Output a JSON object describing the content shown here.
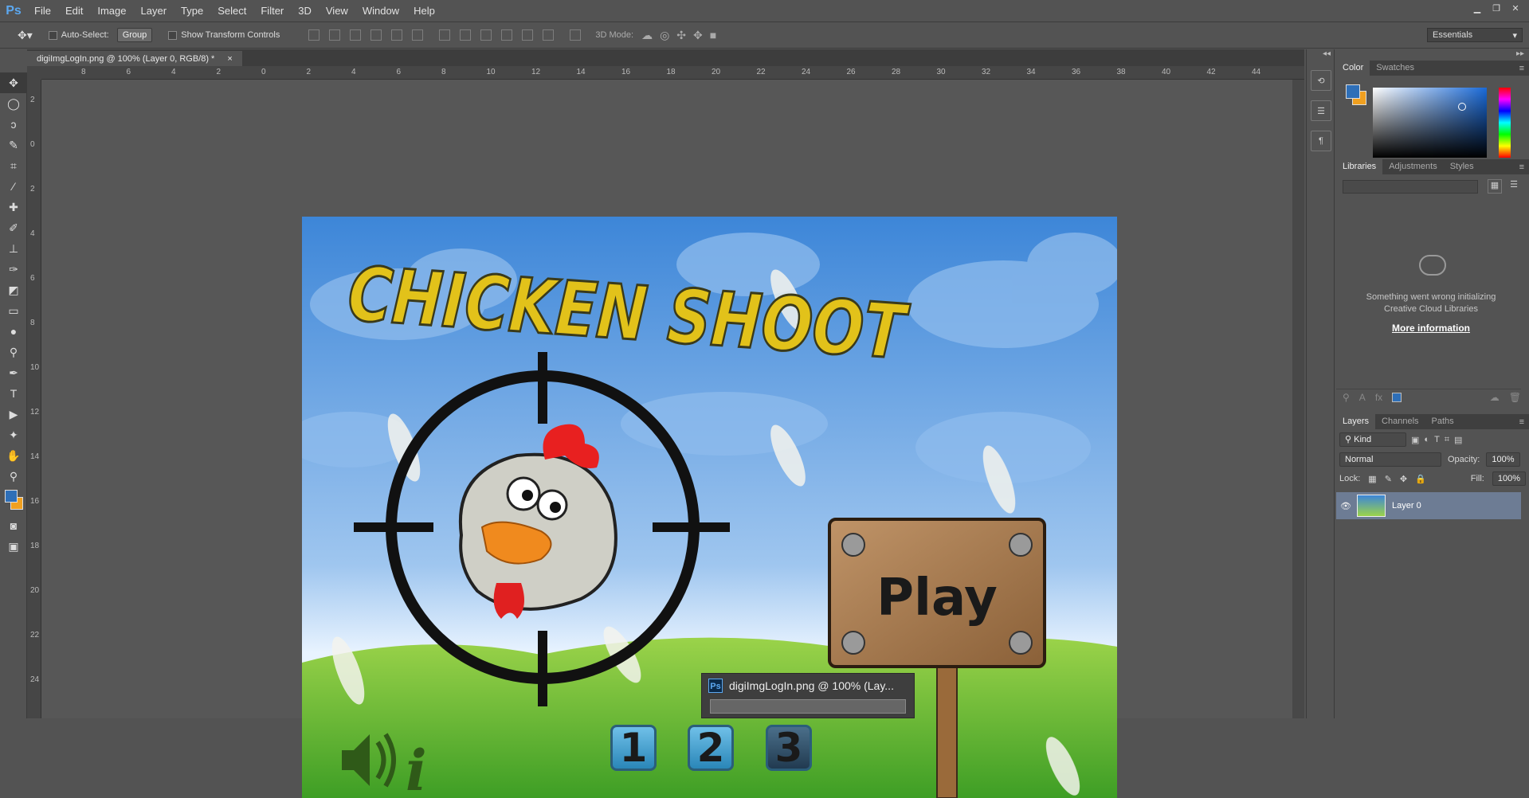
{
  "app": {
    "logo": "Ps"
  },
  "menu": [
    "File",
    "Edit",
    "Image",
    "Layer",
    "Type",
    "Select",
    "Filter",
    "3D",
    "View",
    "Window",
    "Help"
  ],
  "options": {
    "auto_select_label": "Auto-Select:",
    "auto_select_value": "Group",
    "show_transform_label": "Show Transform Controls",
    "mode_3d_label": "3D Mode:",
    "workspace": "Essentials"
  },
  "doc_tab": {
    "title": "digiImgLogIn.png @ 100% (Layer 0, RGB/8) *",
    "close": "×"
  },
  "ruler_h": [
    "8",
    "6",
    "4",
    "2",
    "0",
    "2",
    "4",
    "6",
    "8",
    "10",
    "12",
    "14",
    "16",
    "18",
    "20",
    "22",
    "24",
    "26",
    "28",
    "30",
    "32",
    "34",
    "36",
    "38",
    "40",
    "42",
    "44"
  ],
  "ruler_v": [
    "2",
    "0",
    "2",
    "4",
    "6",
    "8",
    "10",
    "12",
    "14",
    "16",
    "18",
    "20",
    "22",
    "24"
  ],
  "canvas": {
    "title": "CHICKEN SHOOT",
    "play": "Play",
    "level_buttons": [
      "1",
      "2",
      "3"
    ],
    "info_glyph": "i"
  },
  "panels": {
    "color_tabs": [
      "Color",
      "Swatches"
    ],
    "lib_tabs": [
      "Libraries",
      "Adjustments",
      "Styles"
    ],
    "lib_error_line1": "Something went wrong initializing",
    "lib_error_line2": "Creative Cloud Libraries",
    "lib_link": "More information",
    "layers_tabs": [
      "Layers",
      "Channels",
      "Paths"
    ],
    "kind": "Kind",
    "blend_mode": "Normal",
    "opacity_label": "Opacity:",
    "opacity_value": "100%",
    "lock_label": "Lock:",
    "fill_label": "Fill:",
    "fill_value": "100%",
    "layer_name": "Layer 0"
  },
  "taskbar_popup": {
    "title": "digiImgLogIn.png @ 100% (Lay..."
  },
  "colors": {
    "foreground": "#2e6fb8",
    "background": "#f0a020",
    "accent": "#5ca8f0"
  }
}
